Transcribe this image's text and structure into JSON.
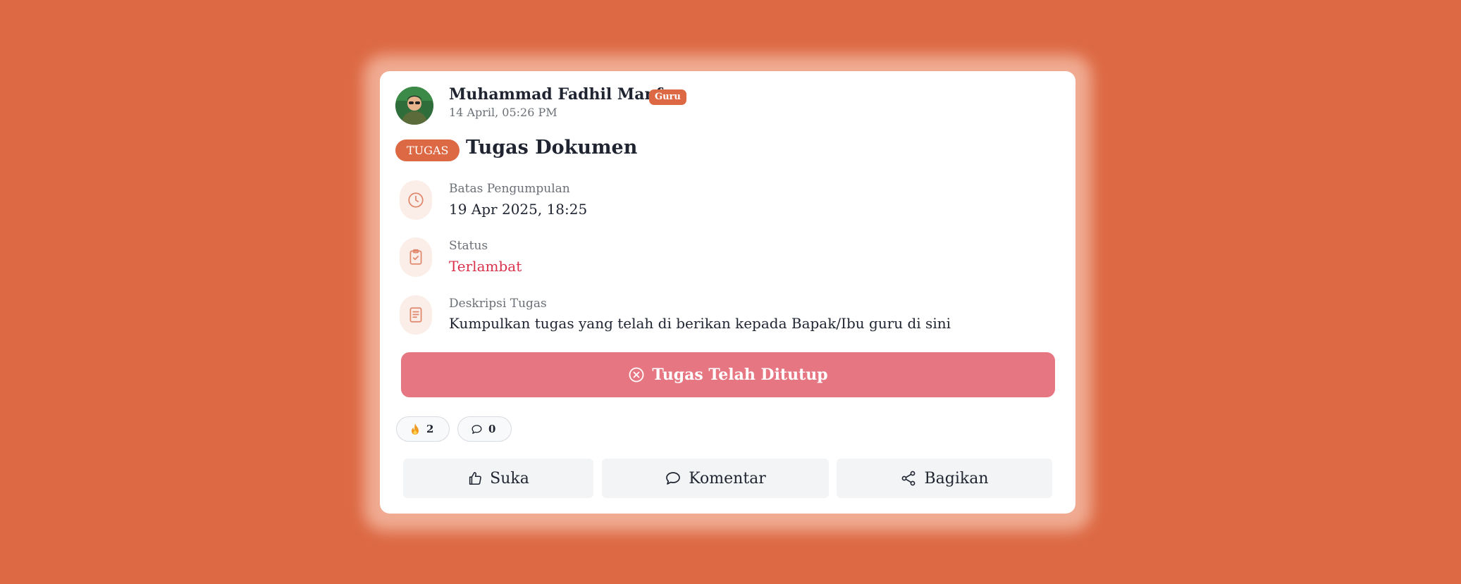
{
  "post": {
    "author_name": "Muhammad Fadhil Manfa",
    "author_role": "Guru",
    "timestamp": "14 April, 05:26 PM",
    "type_badge": "TUGAS",
    "title": "Tugas Dokumen"
  },
  "details": {
    "deadline": {
      "label": "Batas Pengumpulan",
      "value": "19 Apr 2025, 18:25",
      "icon": "clock-icon"
    },
    "status": {
      "label": "Status",
      "value": "Terlambat",
      "icon": "clipboard-check-icon",
      "color": "#D9314B"
    },
    "description": {
      "label": "Deskripsi Tugas",
      "value": "Kumpulkan tugas yang telah di berikan kepada Bapak/Ibu guru di sini",
      "icon": "document-icon"
    }
  },
  "closed_button": {
    "label": "Tugas Telah Ditutup",
    "icon": "x-circle-icon",
    "color": "#E67782"
  },
  "reactions": {
    "fire_count": "2",
    "comment_count": "0"
  },
  "actions": {
    "like": "Suka",
    "comment": "Komentar",
    "share": "Bagikan"
  },
  "colors": {
    "background": "#DD6944",
    "accent": "#DD6944"
  }
}
